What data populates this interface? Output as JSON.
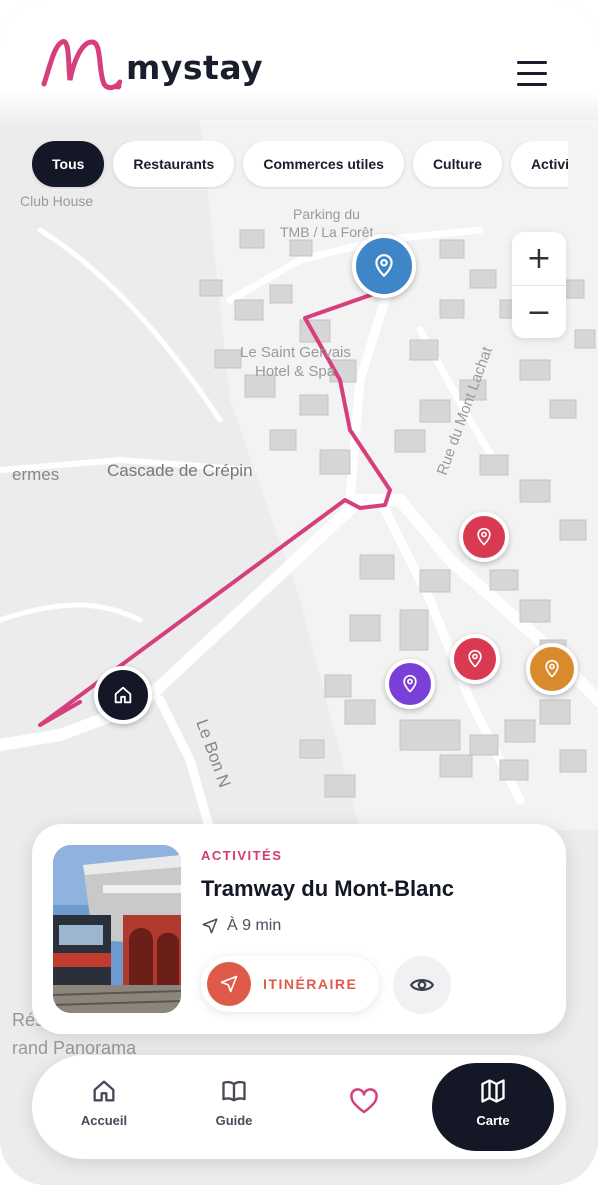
{
  "app": {
    "brand": "mystay"
  },
  "header": {
    "menu_icon": "hamburger-icon"
  },
  "filters": [
    {
      "label": "Tous",
      "active": true
    },
    {
      "label": "Restaurants",
      "active": false
    },
    {
      "label": "Commerces utiles",
      "active": false
    },
    {
      "label": "Culture",
      "active": false
    },
    {
      "label": "Activités",
      "active": false
    }
  ],
  "map": {
    "labels": {
      "club_house": "Club House",
      "parking": "Parking du",
      "parking2": "TMB / La Forêt",
      "hotel": "Le Saint Gervais",
      "hotel2": "Hotel & Spa",
      "cascade": "Cascade de Crépin",
      "thermes": "ermes",
      "rue": "Rue du Mont Lachat",
      "bonn": "Le Bon N",
      "res": "Rés",
      "grand_panorama": "rand Panorama"
    },
    "zoom_in": "+",
    "zoom_out": "−",
    "colors": {
      "route": "#d63f7e",
      "poi_blue": "#3f86c8",
      "poi_red": "#d93a52",
      "poi_purple": "#7a3fd6",
      "poi_orange": "#d98a2c",
      "home": "#141826"
    }
  },
  "card": {
    "category": "ACTIVITÉS",
    "title": "Tramway du Mont-Blanc",
    "distance": "À 9 min",
    "itinerary_label": "ITINÉRAIRE"
  },
  "nav": {
    "items": [
      {
        "label": "Accueil",
        "icon": "home-icon"
      },
      {
        "label": "Guide",
        "icon": "book-icon"
      },
      {
        "label": "",
        "icon": "heart-icon"
      },
      {
        "label": "Carte",
        "icon": "map-icon",
        "active": true
      }
    ]
  }
}
